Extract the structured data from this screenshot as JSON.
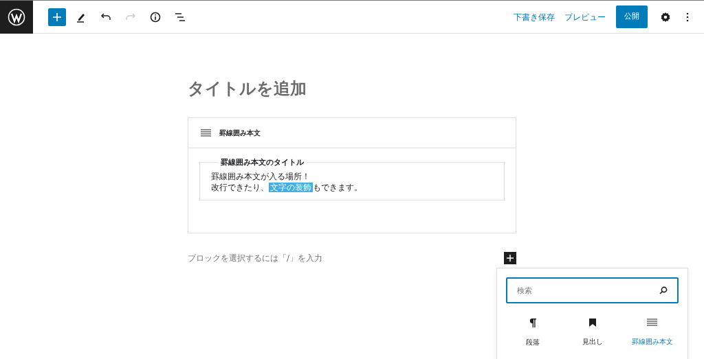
{
  "toolbar": {
    "tools": [
      {
        "kind": "add",
        "disabled": false
      },
      {
        "kind": "pen",
        "disabled": false
      },
      {
        "kind": "undo",
        "disabled": false
      },
      {
        "kind": "redo",
        "disabled": true
      },
      {
        "kind": "info",
        "disabled": false
      },
      {
        "kind": "outline",
        "disabled": false
      }
    ],
    "save_draft": "下書き保存",
    "preview": "プレビュー",
    "publish": "公開"
  },
  "title_placeholder": "タイトルを追加",
  "block": {
    "name": "罫線囲み本文",
    "box_title": "罫線囲み本文のタイトル",
    "lines": [
      [
        {
          "text": "罫線囲み本文が入る場所！",
          "highlighted": false
        }
      ],
      [
        {
          "text": "改行できたり、",
          "highlighted": false
        },
        {
          "text": "文字の装飾",
          "highlighted": true
        },
        {
          "text": "もできます。",
          "highlighted": false
        }
      ]
    ]
  },
  "appender_placeholder": "ブロックを選択するには「/」を入力",
  "inserter": {
    "search": {
      "placeholder": "検索"
    },
    "blocks": [
      {
        "kind": "paragraph",
        "label": "段落",
        "selected": false
      },
      {
        "kind": "heading",
        "label": "見出し",
        "selected": false
      },
      {
        "kind": "lines",
        "label": "罫線囲み本文",
        "selected": true
      }
    ]
  }
}
